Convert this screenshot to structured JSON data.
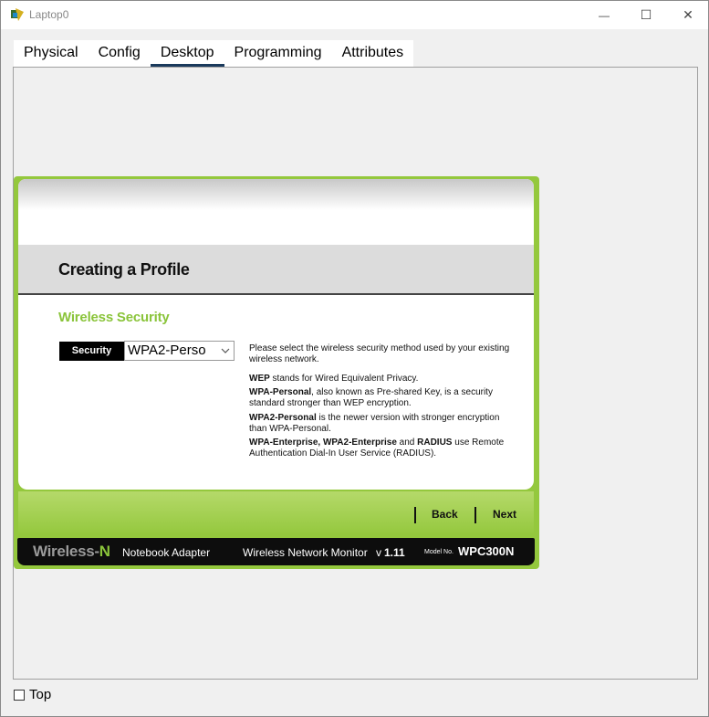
{
  "window": {
    "title": "Laptop0",
    "minimize_glyph": "—",
    "maximize_glyph": "☐",
    "close_glyph": "✕"
  },
  "tabs": [
    {
      "label": "Physical"
    },
    {
      "label": "Config"
    },
    {
      "label": "Desktop",
      "active": true
    },
    {
      "label": "Programming"
    },
    {
      "label": "Attributes"
    }
  ],
  "wizard": {
    "page_title": "Creating a Profile",
    "section_title": "Wireless Security",
    "security_label": "Security",
    "security_value": "WPA2-Perso",
    "intro": "Please select the wireless security method used by your existing wireless network.",
    "wep_term": "WEP",
    "wep_desc": " stands for Wired Equivalent Privacy.",
    "wpa_term": "WPA-Personal",
    "wpa_desc": ", also known as Pre-shared Key, is a security standard stronger than WEP encryption.",
    "wpa2_term": "WPA2-Personal",
    "wpa2_desc": " is the newer version with stronger encryption than WPA-Personal.",
    "ent_term": "WPA-Enterprise, WPA2-Enterprise",
    "ent_and": " and ",
    "radius_term": "RADIUS",
    "ent_desc": " use Remote Authentication Dial-In User Service (RADIUS).",
    "back_label": "Back",
    "next_label": "Next"
  },
  "footer": {
    "brand_prefix": "Wireless-",
    "brand_suffix": "N",
    "product": "Notebook Adapter",
    "monitor": "Wireless Network Monitor",
    "version_prefix": "v",
    "version": "1.11",
    "model_label": "Model No.",
    "model_no": "WPC300N"
  },
  "bottom": {
    "top_label": "Top",
    "top_checked": false
  },
  "colors": {
    "accent_green": "#94c83d",
    "tab_underline": "#1a3a5c"
  }
}
